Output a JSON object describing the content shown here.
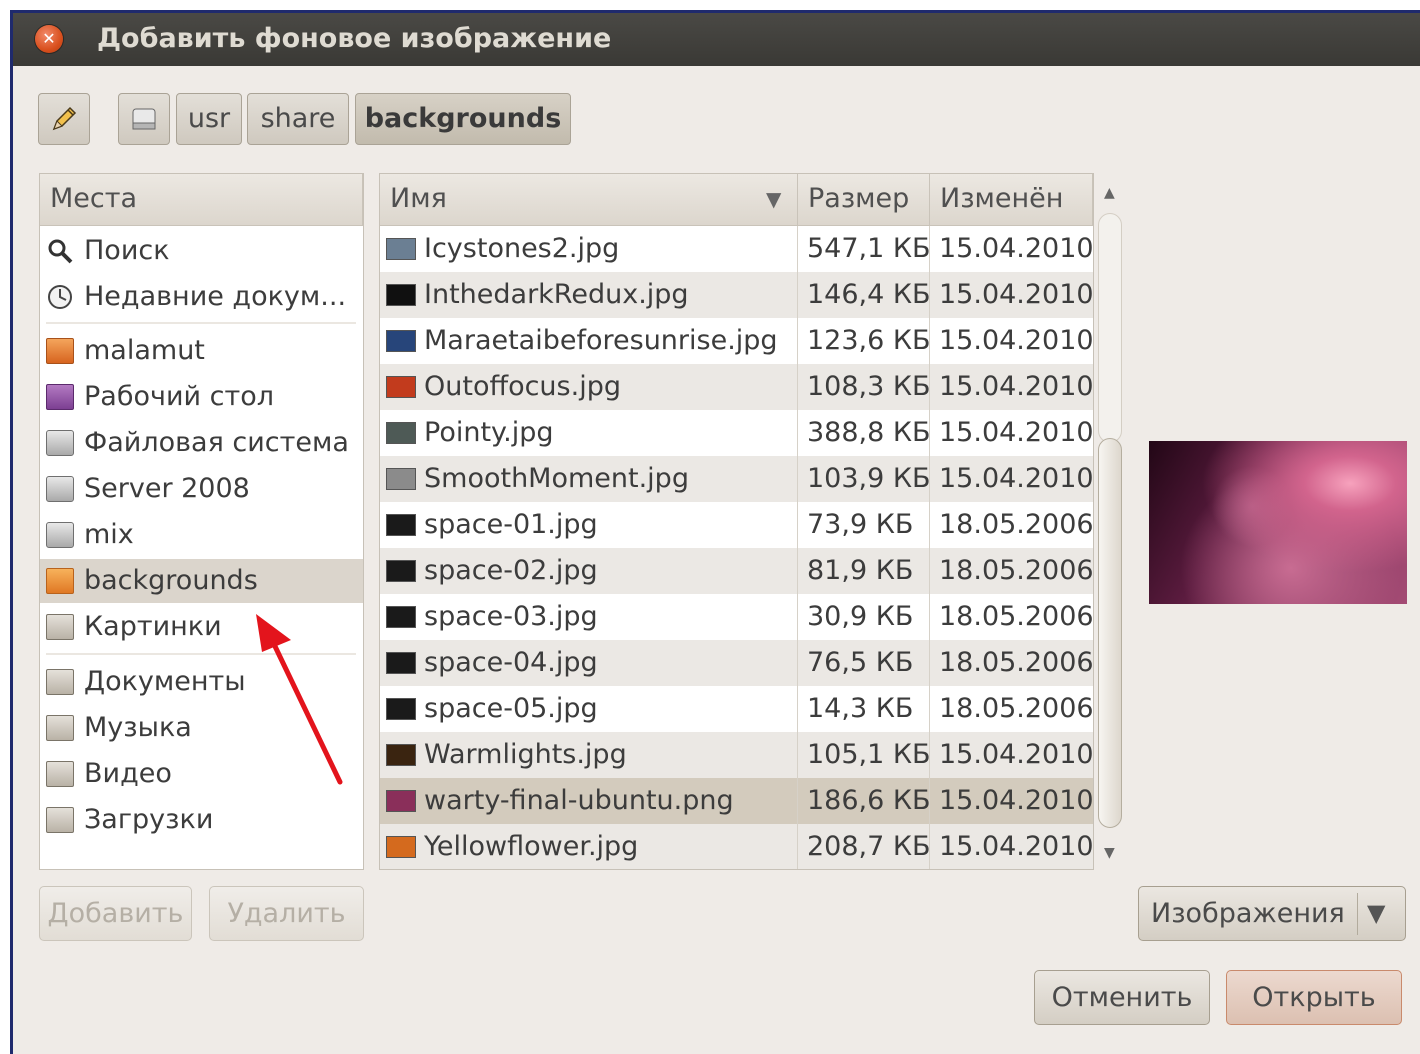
{
  "window": {
    "title": "Добавить фоновое изображение"
  },
  "pathbar": {
    "edit_icon": "pencil-icon",
    "root_icon": "drive-icon",
    "segments": [
      "usr",
      "share",
      "backgrounds"
    ]
  },
  "places": {
    "header": "Места",
    "items": [
      {
        "label": "Поиск",
        "icon": "search-icon"
      },
      {
        "label": "Недавние докум...",
        "icon": "recent-icon"
      },
      {
        "label": "malamut",
        "icon": "home-folder-icon"
      },
      {
        "label": "Рабочий стол",
        "icon": "desktop-icon"
      },
      {
        "label": "Файловая система",
        "icon": "drive-icon"
      },
      {
        "label": "Server 2008",
        "icon": "drive-icon"
      },
      {
        "label": "mix",
        "icon": "drive-icon"
      },
      {
        "label": "backgrounds",
        "icon": "folder-icon",
        "selected": true
      },
      {
        "label": "Картинки",
        "icon": "pictures-folder-icon"
      },
      {
        "label": "Документы",
        "icon": "documents-folder-icon"
      },
      {
        "label": "Музыка",
        "icon": "music-folder-icon"
      },
      {
        "label": "Видео",
        "icon": "video-folder-icon"
      },
      {
        "label": "Загрузки",
        "icon": "downloads-folder-icon"
      }
    ],
    "add_button": "Добавить",
    "remove_button": "Удалить"
  },
  "files": {
    "columns": {
      "name": "Имя",
      "size": "Размер",
      "modified": "Изменён",
      "sort_indicator": "▼"
    },
    "rows": [
      {
        "name": "Icystones2.jpg",
        "size": "547,1 КБ",
        "modified": "15.04.2010"
      },
      {
        "name": "InthedarkRedux.jpg",
        "size": "146,4 КБ",
        "modified": "15.04.2010"
      },
      {
        "name": "Maraetaibeforesunrise.jpg",
        "size": "123,6 КБ",
        "modified": "15.04.2010"
      },
      {
        "name": "Outoffocus.jpg",
        "size": "108,3 КБ",
        "modified": "15.04.2010"
      },
      {
        "name": "Pointy.jpg",
        "size": "388,8 КБ",
        "modified": "15.04.2010"
      },
      {
        "name": "SmoothMoment.jpg",
        "size": "103,9 КБ",
        "modified": "15.04.2010"
      },
      {
        "name": "space-01.jpg",
        "size": "73,9 КБ",
        "modified": "18.05.2006"
      },
      {
        "name": "space-02.jpg",
        "size": "81,9 КБ",
        "modified": "18.05.2006"
      },
      {
        "name": "space-03.jpg",
        "size": "30,9 КБ",
        "modified": "18.05.2006"
      },
      {
        "name": "space-04.jpg",
        "size": "76,5 КБ",
        "modified": "18.05.2006"
      },
      {
        "name": "space-05.jpg",
        "size": "14,3 КБ",
        "modified": "18.05.2006"
      },
      {
        "name": "Warmlights.jpg",
        "size": "105,1 КБ",
        "modified": "15.04.2010"
      },
      {
        "name": "warty-final-ubuntu.png",
        "size": "186,6 КБ",
        "modified": "15.04.2010",
        "selected": true
      },
      {
        "name": "Yellowflower.jpg",
        "size": "208,7 КБ",
        "modified": "15.04.2010"
      }
    ],
    "thumb_colors": [
      "#6b7f93",
      "#101010",
      "#27457a",
      "#c23b1d",
      "#4e5a56",
      "#8b8b8b",
      "#1a1a1a",
      "#1a1a1a",
      "#1a1a1a",
      "#1a1a1a",
      "#1a1a1a",
      "#3a2410",
      "#8a2f5a",
      "#d46a1e"
    ]
  },
  "filter": {
    "label": "Изображения",
    "arrow": "▼"
  },
  "actions": {
    "cancel": "Отменить",
    "open": "Открыть"
  },
  "colors": {
    "annotation_arrow": "#e3141c",
    "titlebar": "#3c3b37"
  }
}
